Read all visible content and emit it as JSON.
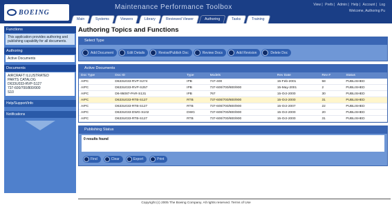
{
  "header": {
    "logo_text": "BOEING",
    "title": "Maintenance Performance Toolbox",
    "links": [
      "View",
      "Prefs",
      "Admin",
      "Help",
      "Account",
      "Log"
    ],
    "logged_in": "Welcome, Authoring Pu"
  },
  "tabs": [
    {
      "label": "Main",
      "active": false
    },
    {
      "label": "Systems",
      "active": false
    },
    {
      "label": "Viewers",
      "active": false
    },
    {
      "label": "Library",
      "active": false
    },
    {
      "label": "Reviewed Viewer",
      "active": false
    },
    {
      "label": "Authoring",
      "active": true
    },
    {
      "label": "Tasks",
      "active": false
    },
    {
      "label": "Training",
      "active": false
    }
  ],
  "sidebar": {
    "section1_title": "Functions",
    "section1_text": "This application provides authoring and publishing capability for all documents.",
    "section2_title": "Authoring",
    "section2_item": "Active Documents",
    "section3_title": "Documents",
    "section3_list": [
      "AIRCRAFT ILLUSTRATED",
      "PARTS CATALOG",
      "D633U033-RVP-S127",
      "737-600/700/800/900",
      "S10"
    ],
    "section4_title": "Help/Support/Info",
    "section5_title": "Notifications"
  },
  "main": {
    "page_title": "Authoring Topics and Functions",
    "function_panel_title": "Select Type",
    "function_buttons": [
      "Add Document",
      "Edit Details",
      "Revise/Publish Doc",
      "Review Docs",
      "Add Revision",
      "Delete Doc"
    ],
    "docs_panel_title": "Active Documents",
    "columns": [
      "Doc Type",
      "Doc ID",
      "Type",
      "Models",
      "Rev Date",
      "Rev #",
      "Status"
    ],
    "rows": [
      [
        "AIPC",
        "D633U033-RVP-S274",
        "IPB",
        "747-400",
        "15-Feb-2001",
        "58",
        "PUBLISHED"
      ],
      [
        "AIPC",
        "D633U033-RVP-S257",
        "IPB",
        "737-600/700/800/900",
        "15-May-2001",
        "2",
        "PUBLISHED"
      ],
      [
        "AIPC",
        "D6-95087-PAR-S131",
        "IPB",
        "767",
        "15-Oct-2000",
        "30",
        "PUBLISHED"
      ],
      [
        "AIPC",
        "D633U033-RTB-S127",
        "RTB",
        "737-600/700/800/900",
        "15-Oct-2000",
        "31",
        "PUBLISHED"
      ],
      [
        "AIPC",
        "D633U033-RTB-S127",
        "RTB",
        "737-600/700/800/900",
        "15-Oct-2007",
        "22",
        "PUBLISHED"
      ],
      [
        "AIPC",
        "D633U033-DWG-S102",
        "DWG",
        "737-600/700/800/900",
        "15-Oct-2000",
        "20",
        "PUBLISHED"
      ],
      [
        "AIPC",
        "D633U033-RTB-S127",
        "RTB",
        "737-600/700/800/900",
        "15-Oct-2000",
        "31",
        "PUBLISHED"
      ]
    ],
    "highlight_row": 3,
    "search_panel_title": "Publishing Status",
    "results_text": "0 results found",
    "search_buttons": [
      "Find",
      "Clear",
      "Export",
      "Print"
    ]
  },
  "footer": {
    "text": "Copyright (c) 2005 The Boeing Company. All rights reserved. Terms of Use"
  }
}
